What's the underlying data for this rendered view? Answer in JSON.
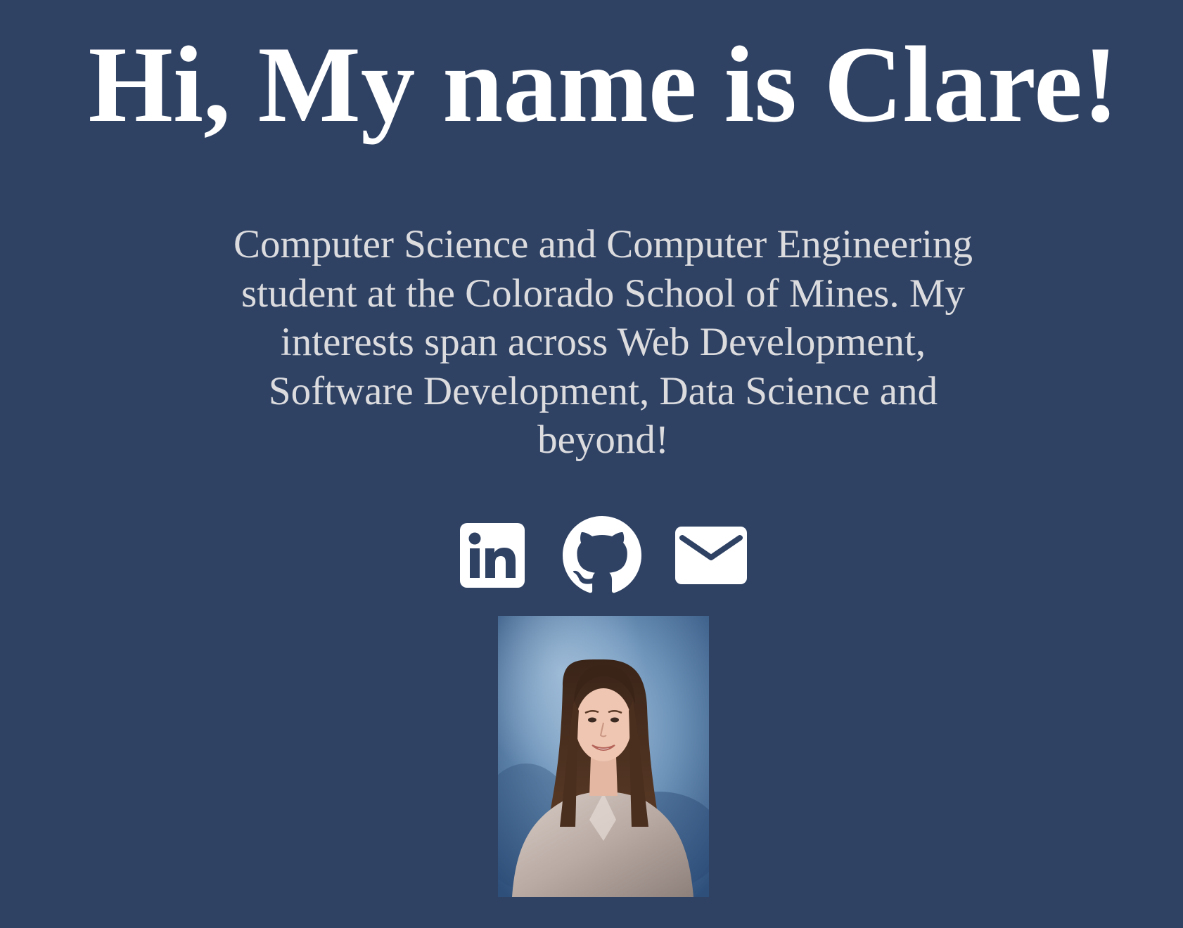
{
  "heading": {
    "title": "Hi, My name is Clare!"
  },
  "bio": {
    "text": "Computer Science and Computer Engineering student at the Colorado School of Mines. My interests span across Web Development, Software Development, Data Science and beyond!"
  },
  "social_links": [
    {
      "icon": "linkedin-icon"
    },
    {
      "icon": "github-icon"
    },
    {
      "icon": "email-icon"
    }
  ],
  "profile_photo": {
    "subject": "portrait-photo"
  },
  "colors": {
    "background": "#2f4264",
    "title": "#ffffff",
    "bio_text": "#dcdcdf",
    "icons": "#ffffff"
  }
}
